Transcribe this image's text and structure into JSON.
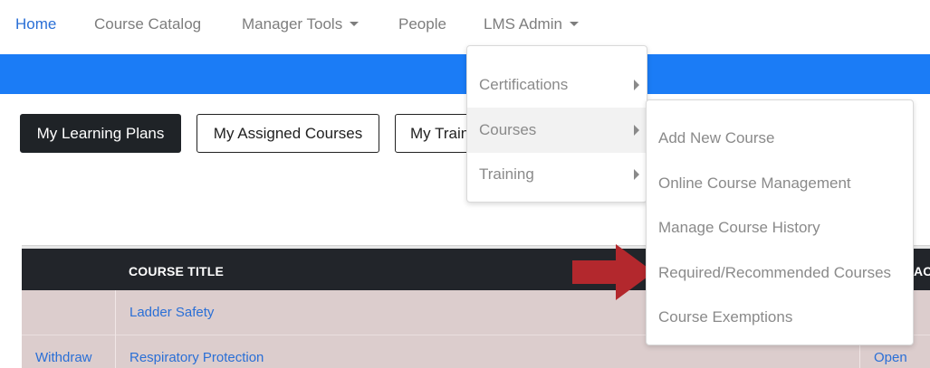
{
  "nav": {
    "home": "Home",
    "catalog": "Course Catalog",
    "manager_tools": "Manager Tools",
    "people": "People",
    "lms_admin": "LMS Admin"
  },
  "buttons": {
    "learning_plans": "My Learning Plans",
    "assigned_courses": "My Assigned Courses",
    "training": "My Training"
  },
  "table": {
    "col_title": "COURSE TITLE",
    "col_right": "ACH/",
    "rows": [
      {
        "action": "",
        "title": "Ladder Safety",
        "right": ""
      },
      {
        "action": "Withdraw",
        "title": "Respiratory Protection",
        "right": "Open"
      }
    ]
  },
  "lms_menu": {
    "items": [
      "Certifications",
      "Courses",
      "Training"
    ]
  },
  "courses_submenu": {
    "items": [
      "Add New Course",
      "Online Course Management",
      "Manage Course History",
      "Required/Recommended Courses",
      "Course Exemptions"
    ]
  },
  "colors": {
    "brand_blue": "#1b7cf6",
    "link_blue": "#2a6fd6",
    "header_dark": "#22252a",
    "row_bg": "#dccdcd",
    "arrow_red": "#b3282d"
  },
  "icons": {
    "dropdown_caret": "caret-down-icon",
    "submenu_arrow": "chevron-right-icon",
    "annotation_arrow": "red-arrow-icon"
  }
}
